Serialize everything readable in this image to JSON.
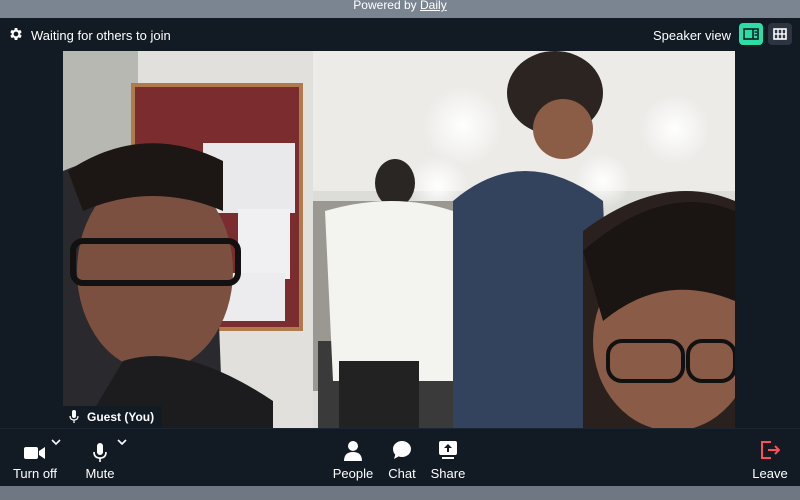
{
  "banner": {
    "prefix": "Powered by",
    "link": "Daily"
  },
  "header": {
    "status": "Waiting for others to join",
    "view_label": "Speaker view"
  },
  "video": {
    "participant_name": "Guest (You)"
  },
  "toolbar": {
    "camera_label": "Turn off",
    "mic_label": "Mute",
    "people_label": "People",
    "chat_label": "Chat",
    "share_label": "Share",
    "leave_label": "Leave"
  },
  "colors": {
    "accent": "#2bdfa4",
    "leave": "#ff4d57",
    "background": "#121a24"
  }
}
